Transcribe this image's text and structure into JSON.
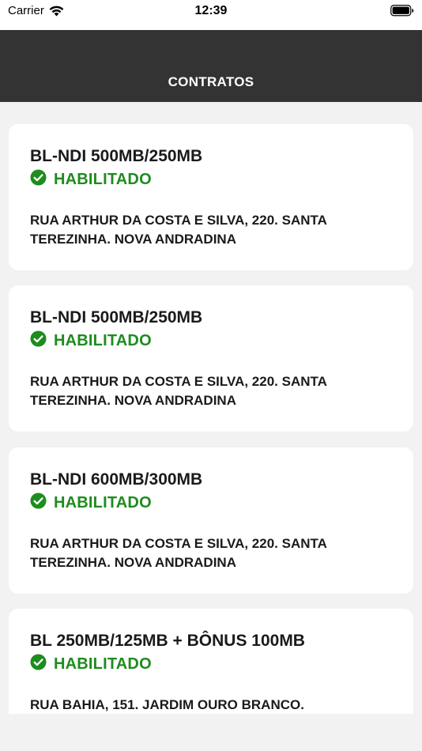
{
  "status_bar": {
    "carrier": "Carrier",
    "time": "12:39"
  },
  "header": {
    "title": "CONTRATOS"
  },
  "contracts": [
    {
      "plan": "BL-NDI 500MB/250MB",
      "status": "HABILITADO",
      "address": "RUA ARTHUR DA COSTA E SILVA, 220. SANTA TEREZINHA. NOVA ANDRADINA"
    },
    {
      "plan": "BL-NDI 500MB/250MB",
      "status": "HABILITADO",
      "address": "RUA ARTHUR DA COSTA E SILVA, 220. SANTA TEREZINHA. NOVA ANDRADINA"
    },
    {
      "plan": "BL-NDI 600MB/300MB",
      "status": "HABILITADO",
      "address": "RUA ARTHUR DA COSTA E SILVA, 220. SANTA TEREZINHA. NOVA ANDRADINA"
    },
    {
      "plan": "BL 250MB/125MB + BÔNUS 100MB",
      "status": "HABILITADO",
      "address": "RUA BAHIA, 151. JARDIM OURO BRANCO."
    }
  ],
  "colors": {
    "header_bg": "#333333",
    "status_green": "#1e8c1e",
    "page_bg": "#f2f2f2"
  },
  "icons": {
    "status": "check-circle-icon",
    "wifi": "wifi-icon",
    "battery": "battery-icon"
  }
}
